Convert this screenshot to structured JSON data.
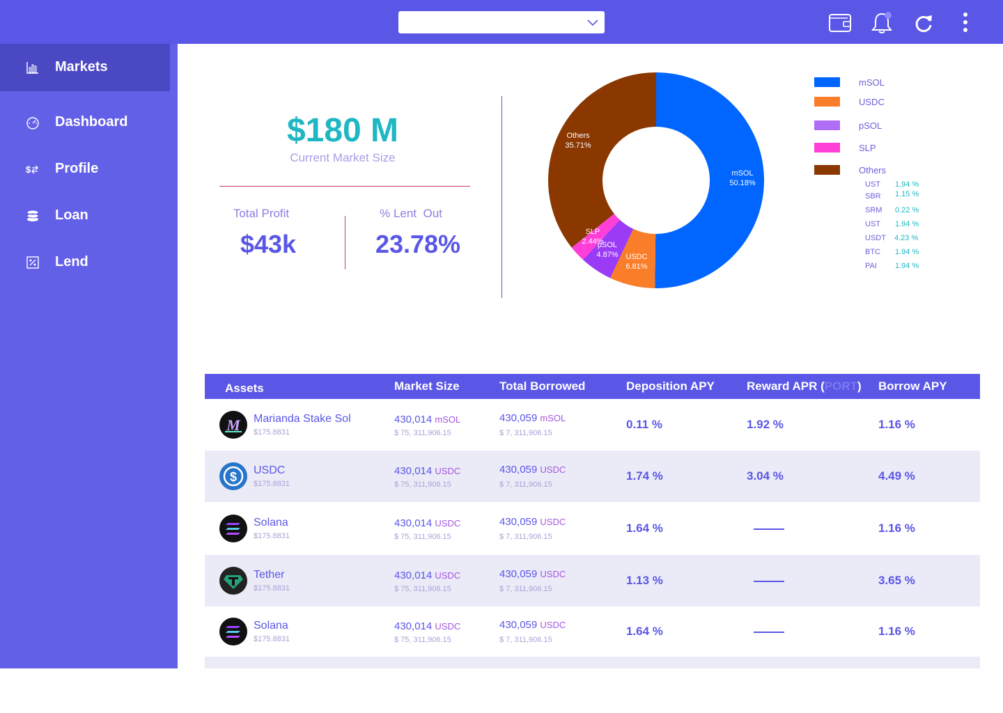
{
  "topbar": {
    "select_value": "",
    "icons": [
      "wallet-icon",
      "bell-icon",
      "refresh-icon",
      "more-vertical-icon"
    ]
  },
  "sidebar": {
    "items": [
      {
        "label": "Markets",
        "icon": "bar-chart-icon",
        "active": true
      },
      {
        "label": "Dashboard",
        "icon": "speedometer-icon",
        "active": false
      },
      {
        "label": "Profile",
        "icon": "dollar-transfer-icon",
        "active": false
      },
      {
        "label": "Loan",
        "icon": "coins-stack-icon",
        "active": false
      },
      {
        "label": "Lend",
        "icon": "percent-icon",
        "active": false
      }
    ]
  },
  "stats": {
    "market_size": "$180 M",
    "market_size_label": "Current Market Size",
    "total_profit_label": "Total Profit",
    "total_profit": "$43k",
    "lent_out_label": "% Lent  Out",
    "lent_out": "23.78%"
  },
  "chart_data": {
    "type": "pie",
    "slices": [
      {
        "name": "mSOL",
        "value": 50.18,
        "label": "50.18%",
        "color": "#0066ff"
      },
      {
        "name": "USDC",
        "value": 6.81,
        "label": "6.81%",
        "color": "#fa7d2a"
      },
      {
        "name": "pSOL",
        "value": 4.87,
        "label": "4.87%",
        "color": "#9b3bf5"
      },
      {
        "name": "SLP",
        "value": 2.44,
        "label": "2.44%",
        "color": "#ff3fd8"
      },
      {
        "name": "Others",
        "value": 35.71,
        "label": "35.71%",
        "color": "#8a3700"
      }
    ],
    "legend": [
      {
        "name": "mSOL",
        "color": "#0066ff"
      },
      {
        "name": "USDC",
        "color": "#fa7d2a"
      },
      {
        "name": "pSOL",
        "color": "#b06ef7"
      },
      {
        "name": "SLP",
        "color": "#ff3fd8"
      },
      {
        "name": "Others",
        "color": "#8a3700"
      }
    ],
    "others_breakdown": [
      {
        "name": "UST",
        "value": "1.94 %"
      },
      {
        "name": "SBR",
        "value": "1.15 %"
      },
      {
        "name": "SRM",
        "value": "0.22 %"
      },
      {
        "name": "UST",
        "value": "1.94 %"
      },
      {
        "name": "USDT",
        "value": "4.23 %"
      },
      {
        "name": "BTC",
        "value": "1.94 %"
      },
      {
        "name": "PAI",
        "value": "1.94 %"
      }
    ]
  },
  "table": {
    "headers": {
      "assets": "Assets",
      "market_size": "Market Size",
      "total_borrowed": "Total Borrowed",
      "deposition_apy": "Deposition APY",
      "reward_apr_prefix": "Reward APR (",
      "reward_apr_token": "PORT",
      "reward_apr_suffix": ")",
      "borrow_apy": "Borrow APY"
    },
    "rows": [
      {
        "name": "Marianda Stake Sol",
        "price": "$175.8831",
        "icon": "msol-coin-icon",
        "market": "430,014",
        "market_unit": "mSOL",
        "market_usd": "$ 75, 311,906.15",
        "borrowed": "430,059",
        "borrowed_unit": "mSOL",
        "borrowed_usd": "$ 7, 311,906.15",
        "dep_apy": "0.11 %",
        "reward_apr": "1.92 %",
        "borrow_apy": "1.16 %"
      },
      {
        "name": "USDC",
        "price": "$175.8831",
        "icon": "usdc-coin-icon",
        "market": "430,014",
        "market_unit": "USDC",
        "market_usd": "$ 75, 311,906.15",
        "borrowed": "430,059",
        "borrowed_unit": "USDC",
        "borrowed_usd": "$ 7, 311,906.15",
        "dep_apy": "1.74 %",
        "reward_apr": "3.04 %",
        "borrow_apy": "4.49 %"
      },
      {
        "name": "Solana",
        "price": "$175.8831",
        "icon": "solana-coin-icon",
        "market": "430,014",
        "market_unit": "USDC",
        "market_usd": "$ 75, 311,906.15",
        "borrowed": "430,059",
        "borrowed_unit": "USDC",
        "borrowed_usd": "$ 7, 311,906.15",
        "dep_apy": "1.64 %",
        "reward_apr": null,
        "borrow_apy": "1.16 %"
      },
      {
        "name": "Tether",
        "price": "$175.8831",
        "icon": "tether-coin-icon",
        "market": "430,014",
        "market_unit": "USDC",
        "market_usd": "$ 75, 311,906.15",
        "borrowed": "430,059",
        "borrowed_unit": "USDC",
        "borrowed_usd": "$ 7, 311,906.15",
        "dep_apy": "1.13 %",
        "reward_apr": null,
        "borrow_apy": "3.65 %"
      },
      {
        "name": "Solana",
        "price": "$175.8831",
        "icon": "solana-coin-icon",
        "market": "430,014",
        "market_unit": "USDC",
        "market_usd": "$ 75, 311,906.15",
        "borrowed": "430,059",
        "borrowed_unit": "USDC",
        "borrowed_usd": "$ 7, 311,906.15",
        "dep_apy": "1.64 %",
        "reward_apr": null,
        "borrow_apy": "1.16 %"
      }
    ]
  }
}
